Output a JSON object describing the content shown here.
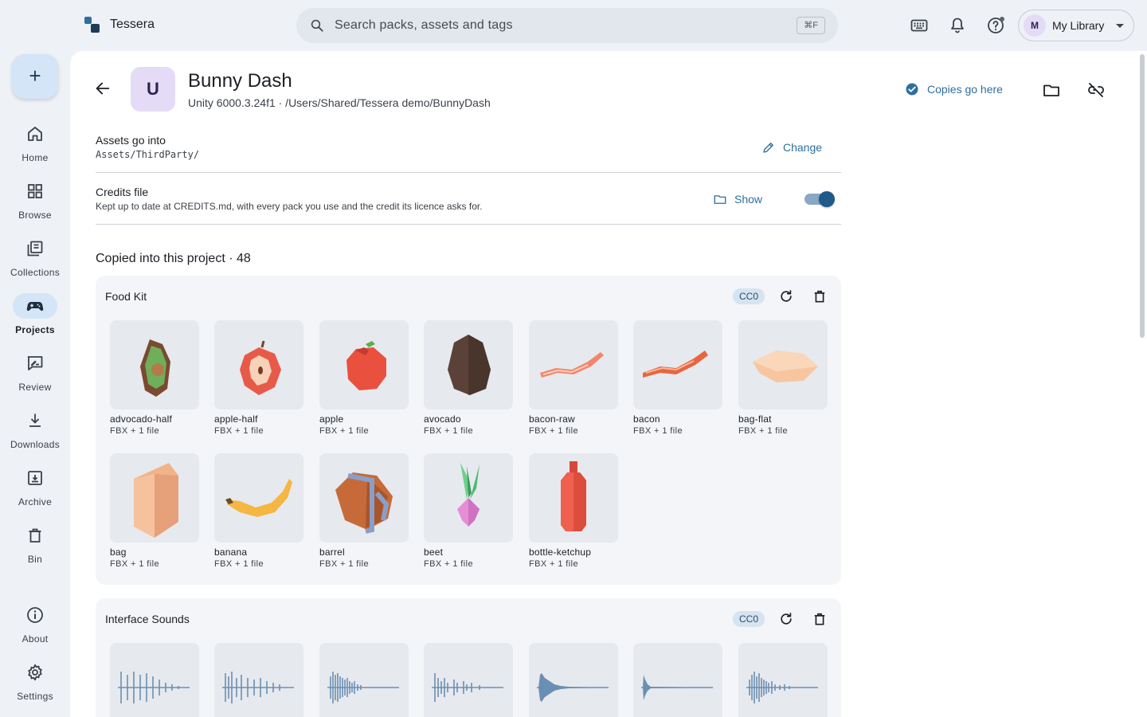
{
  "app": {
    "title": "Tessera"
  },
  "search": {
    "placeholder": "Search packs, assets and tags",
    "shortcut": "⌘F"
  },
  "account": {
    "avatar": "M",
    "label": "My Library"
  },
  "nav": {
    "add_label": "+",
    "items": [
      {
        "label": "Home",
        "icon": "home-icon"
      },
      {
        "label": "Browse",
        "icon": "grid-icon"
      },
      {
        "label": "Collections",
        "icon": "collections-icon"
      },
      {
        "label": "Projects",
        "icon": "gamepad-icon",
        "active": true
      },
      {
        "label": "Review",
        "icon": "review-icon"
      },
      {
        "label": "Downloads",
        "icon": "download-icon"
      },
      {
        "label": "Archive",
        "icon": "archive-icon"
      },
      {
        "label": "Bin",
        "icon": "trash-icon"
      },
      {
        "label": "About",
        "icon": "info-icon"
      },
      {
        "label": "Settings",
        "icon": "gear-icon"
      }
    ]
  },
  "project": {
    "avatar": "U",
    "title": "Bunny Dash",
    "subtitle": "Unity 6000.3.24f1 · /Users/Shared/Tessera demo/BunnyDash",
    "copies_label": "Copies go here"
  },
  "settings": {
    "assets_title": "Assets go into",
    "assets_path": "Assets/ThirdParty/",
    "change_label": "Change",
    "credits_title": "Credits file",
    "credits_desc": "Kept up to date at CREDITS.md, with every pack you use and the credit its licence asks for.",
    "show_label": "Show",
    "credits_enabled": true
  },
  "copied": {
    "heading": "Copied into this project · 48"
  },
  "groups": [
    {
      "title": "Food Kit",
      "license": "CC0",
      "assets": [
        {
          "name": "advocado-half",
          "meta": "FBX + 1 file"
        },
        {
          "name": "apple-half",
          "meta": "FBX + 1 file"
        },
        {
          "name": "apple",
          "meta": "FBX + 1 file"
        },
        {
          "name": "avocado",
          "meta": "FBX + 1 file"
        },
        {
          "name": "bacon-raw",
          "meta": "FBX + 1 file"
        },
        {
          "name": "bacon",
          "meta": "FBX + 1 file"
        },
        {
          "name": "bag-flat",
          "meta": "FBX + 1 file"
        },
        {
          "name": "bag",
          "meta": "FBX + 1 file"
        },
        {
          "name": "banana",
          "meta": "FBX + 1 file"
        },
        {
          "name": "barrel",
          "meta": "FBX + 1 file"
        },
        {
          "name": "beet",
          "meta": "FBX + 1 file"
        },
        {
          "name": "bottle-ketchup",
          "meta": "FBX + 1 file"
        }
      ]
    },
    {
      "title": "Interface Sounds",
      "license": "CC0"
    }
  ],
  "colors": {
    "accent": "#2f6f9f",
    "active_pill": "#d3e5f7",
    "panel": "#ffffff",
    "background": "#eef1f6"
  }
}
